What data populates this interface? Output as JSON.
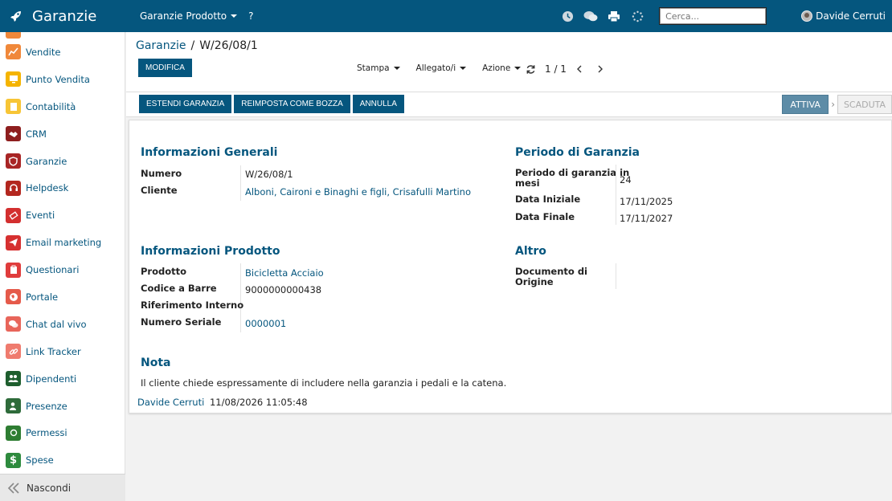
{
  "app": {
    "title": "Garanzie"
  },
  "topmenu": {
    "items": [
      {
        "label": "Garanzie Prodotto"
      },
      {
        "label": "?"
      }
    ]
  },
  "search": {
    "placeholder": "Cerca..."
  },
  "user": {
    "name": "Davide Cerruti"
  },
  "sidebar": {
    "items": [
      {
        "label": "Vendite",
        "color": "#f0883a"
      },
      {
        "label": "Punto Vendita",
        "color": "#f5b400"
      },
      {
        "label": "Contabilità",
        "color": "#f7c536"
      },
      {
        "label": "CRM",
        "color": "#8e1e1e"
      },
      {
        "label": "Garanzie",
        "color": "#a82525"
      },
      {
        "label": "Helpdesk",
        "color": "#b3271f"
      },
      {
        "label": "Eventi",
        "color": "#d32f2f"
      },
      {
        "label": "Email marketing",
        "color": "#d63030"
      },
      {
        "label": "Questionari",
        "color": "#e03c3c"
      },
      {
        "label": "Portale",
        "color": "#e55a4a"
      },
      {
        "label": "Chat dal vivo",
        "color": "#e8655a"
      },
      {
        "label": "Link Tracker",
        "color": "#ef7b6e"
      },
      {
        "label": "Dipendenti",
        "color": "#1e5e2e"
      },
      {
        "label": "Presenze",
        "color": "#2e6b3a"
      },
      {
        "label": "Permessi",
        "color": "#2e7d32"
      },
      {
        "label": "Spese",
        "color": "#2e8b3e"
      }
    ],
    "footer_label": "Nascondi"
  },
  "breadcrumb": {
    "parent": "Garanzie",
    "separator": "/",
    "current": "W/26/08/1"
  },
  "actions": {
    "edit_label": "MODIFICA",
    "print_label": "Stampa",
    "attach_label": "Allegato/i",
    "action_label": "Azione",
    "pager": "1 / 1"
  },
  "statusbar": {
    "buttons": [
      "ESTENDI GARANZIA",
      "REIMPOSTA COME BOZZA",
      "ANNULLA"
    ],
    "stage_active": "ATTIVA",
    "stage_inactive": "SCADUTA"
  },
  "form": {
    "general": {
      "title": "Informazioni Generali",
      "numero_label": "Numero",
      "numero_value": "W/26/08/1",
      "cliente_label": "Cliente",
      "cliente_value": "Alboni, Caironi e Binaghi e figli, Crisafulli Martino"
    },
    "period": {
      "title": "Periodo di Garanzia",
      "mesi_label_1": "Periodo di garanzia in",
      "mesi_label_2": "mesi",
      "mesi_value": "24",
      "inizio_label": "Data Iniziale",
      "inizio_value": "17/11/2025",
      "fine_label": "Data Finale",
      "fine_value": "17/11/2027"
    },
    "product": {
      "title": "Informazioni Prodotto",
      "prodotto_label": "Prodotto",
      "prodotto_value": "Bicicletta Acciaio",
      "barre_label": "Codice a Barre",
      "barre_value": "9000000000438",
      "rif_label": "Riferimento Interno",
      "seriale_label": "Numero Seriale",
      "seriale_value": "0000001"
    },
    "other": {
      "title": "Altro",
      "doc_label_1": "Documento di",
      "doc_label_2": "Origine"
    },
    "note": {
      "title": "Nota",
      "text": "Il cliente chiede espressamente di includere nella garanzia i pedali e la catena."
    },
    "chatter": {
      "author": "Davide Cerruti",
      "timestamp": "11/08/2026 11:05:48"
    }
  },
  "colors": {
    "primary": "#05567e",
    "stage_active": "#5d8ca7"
  }
}
